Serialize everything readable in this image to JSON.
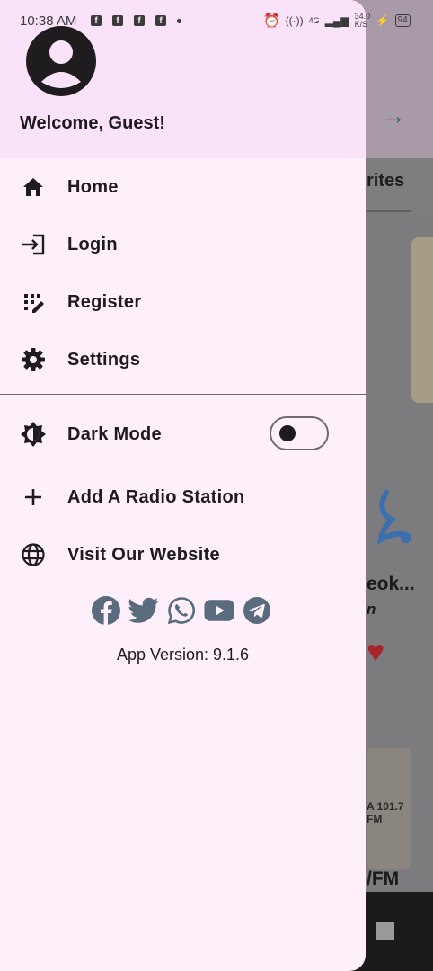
{
  "status_bar": {
    "time": "10:38 AM",
    "network": "4G",
    "speed": "34.0 K/S",
    "battery": "94"
  },
  "background": {
    "tab_label_partial": "rites",
    "station_title_partial": "eok...",
    "station_subtitle_partial": "n",
    "station2_logo_partial": "A 101.7 FM",
    "station2_name_partial": "/FM"
  },
  "drawer": {
    "welcome": "Welcome, Guest!",
    "menu": [
      {
        "label": "Home",
        "icon": "home-icon"
      },
      {
        "label": "Login",
        "icon": "login-icon"
      },
      {
        "label": "Register",
        "icon": "register-icon"
      },
      {
        "label": "Settings",
        "icon": "gear-icon"
      }
    ],
    "dark_mode": {
      "label": "Dark Mode",
      "enabled": false
    },
    "extra": [
      {
        "label": "Add A Radio Station",
        "icon": "plus-icon"
      },
      {
        "label": "Visit Our Website",
        "icon": "globe-icon"
      }
    ],
    "socials": [
      "facebook-icon",
      "twitter-icon",
      "whatsapp-icon",
      "youtube-icon",
      "telegram-icon"
    ],
    "social_color": "#5b6b7e",
    "version": "App Version: 9.1.6"
  }
}
